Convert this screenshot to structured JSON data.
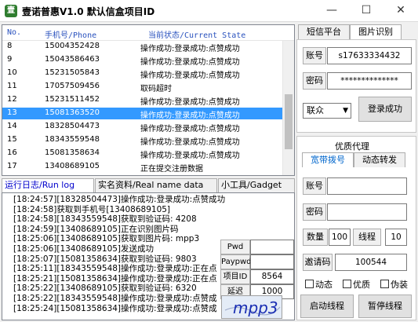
{
  "window": {
    "title": "壹诺普惠V1.0 默认信盒项目ID",
    "app_icon": "app-icon",
    "controls": {
      "minimize": "—",
      "maximize": "☐",
      "close": "✕"
    }
  },
  "list": {
    "columns": {
      "no": "No.",
      "phone": "手机号/Phone",
      "status": "当前状态/Current State"
    },
    "rows": [
      {
        "no": "8",
        "phone": "15004352428",
        "status": "操作成功:登录成功:点赞成功",
        "selected": false
      },
      {
        "no": "9",
        "phone": "15043586463",
        "status": "操作成功:登录成功:点赞成功",
        "selected": false
      },
      {
        "no": "10",
        "phone": "15231505843",
        "status": "操作成功:登录成功:点赞成功",
        "selected": false
      },
      {
        "no": "11",
        "phone": "17057509456",
        "status": "取码超时",
        "selected": false
      },
      {
        "no": "12",
        "phone": "15231511452",
        "status": "操作成功:登录成功:点赞成功",
        "selected": false
      },
      {
        "no": "13",
        "phone": "15081363520",
        "status": "操作成功:登录成功:点赞成功",
        "selected": true
      },
      {
        "no": "14",
        "phone": "18328504473",
        "status": "操作成功:登录成功:点赞成功",
        "selected": false
      },
      {
        "no": "15",
        "phone": "18343559548",
        "status": "操作成功:登录成功:点赞成功",
        "selected": false
      },
      {
        "no": "16",
        "phone": "15081358634",
        "status": "操作成功:登录成功:点赞成功",
        "selected": false
      },
      {
        "no": "17",
        "phone": "13408689105",
        "status": "正在提交注册数据",
        "selected": false
      }
    ]
  },
  "tabs": [
    {
      "label": "运行日志/Run log",
      "active": true
    },
    {
      "label": "实名资料/Real name data",
      "active": false
    },
    {
      "label": "小工具/Gadget",
      "active": false
    }
  ],
  "log": [
    "[18:24:57][18328504473]操作成功:登录成功:点赞成功",
    "[18:24:58]获取到手机号[13408689105]",
    "[18:24:58][18343559548]获取到验证码: 4208",
    "[18:24:59][13408689105]正在识别图片码",
    "[18:25:06][13408689105]获取到图片码: mpp3",
    "[18:25:06][13408689105]发送成功",
    "[18:25:07][15081358634]获取到验证码: 9803",
    "[18:25:11][18343559548]操作成功:登录成功:正在点",
    "[18:25:21][15081358634]操作成功:登录成功:正在点",
    "[18:25:22][13408689105]获取到验证码: 6320",
    "[18:25:22][18343559548]操作成功:登录成功:点赞成",
    "[18:25:24][15081358634]操作成功:登录成功:点赞成"
  ],
  "captcha_panel": {
    "pwd_label": "Pwd",
    "pwd_value": "",
    "paypwd_label": "Paypwd",
    "paypwd_value": "",
    "project_label": "项目ID",
    "project_value": "8564",
    "delay_label": "延迟",
    "delay_value": "1000",
    "captcha_text": "mpp3"
  },
  "right_top": {
    "tabs": [
      {
        "label": "短信平台",
        "active": false
      },
      {
        "label": "图片识别",
        "active": true
      }
    ],
    "account_label": "账号",
    "account_value": "s17633334432",
    "password_label": "密码",
    "password_value": "**************",
    "provider_value": "联众",
    "login_button": "登录成功"
  },
  "right_bottom": {
    "group_title": "优质代理",
    "tabs": [
      {
        "label": "宽带拨号",
        "active": true
      },
      {
        "label": "动态转发",
        "active": false
      }
    ],
    "account_label": "账号",
    "account_value": "",
    "password_label": "密码",
    "password_value": "",
    "count_label": "数量",
    "count_value": "100",
    "threads_label": "线程",
    "threads_value": "10",
    "invite_label": "邀请码",
    "invite_value": "100544",
    "options": [
      {
        "label": "动态",
        "checked": false
      },
      {
        "label": "优质",
        "checked": false
      },
      {
        "label": "伪装",
        "checked": false
      }
    ],
    "start_button": "启动线程",
    "pause_button": "暂停线程"
  },
  "colors": {
    "selection": "#3399ff",
    "header_text": "#2a52be",
    "active_tab_text": "#0000cc",
    "tab_blue": "#0066cc",
    "captcha_ink": "#1b2fb3"
  }
}
